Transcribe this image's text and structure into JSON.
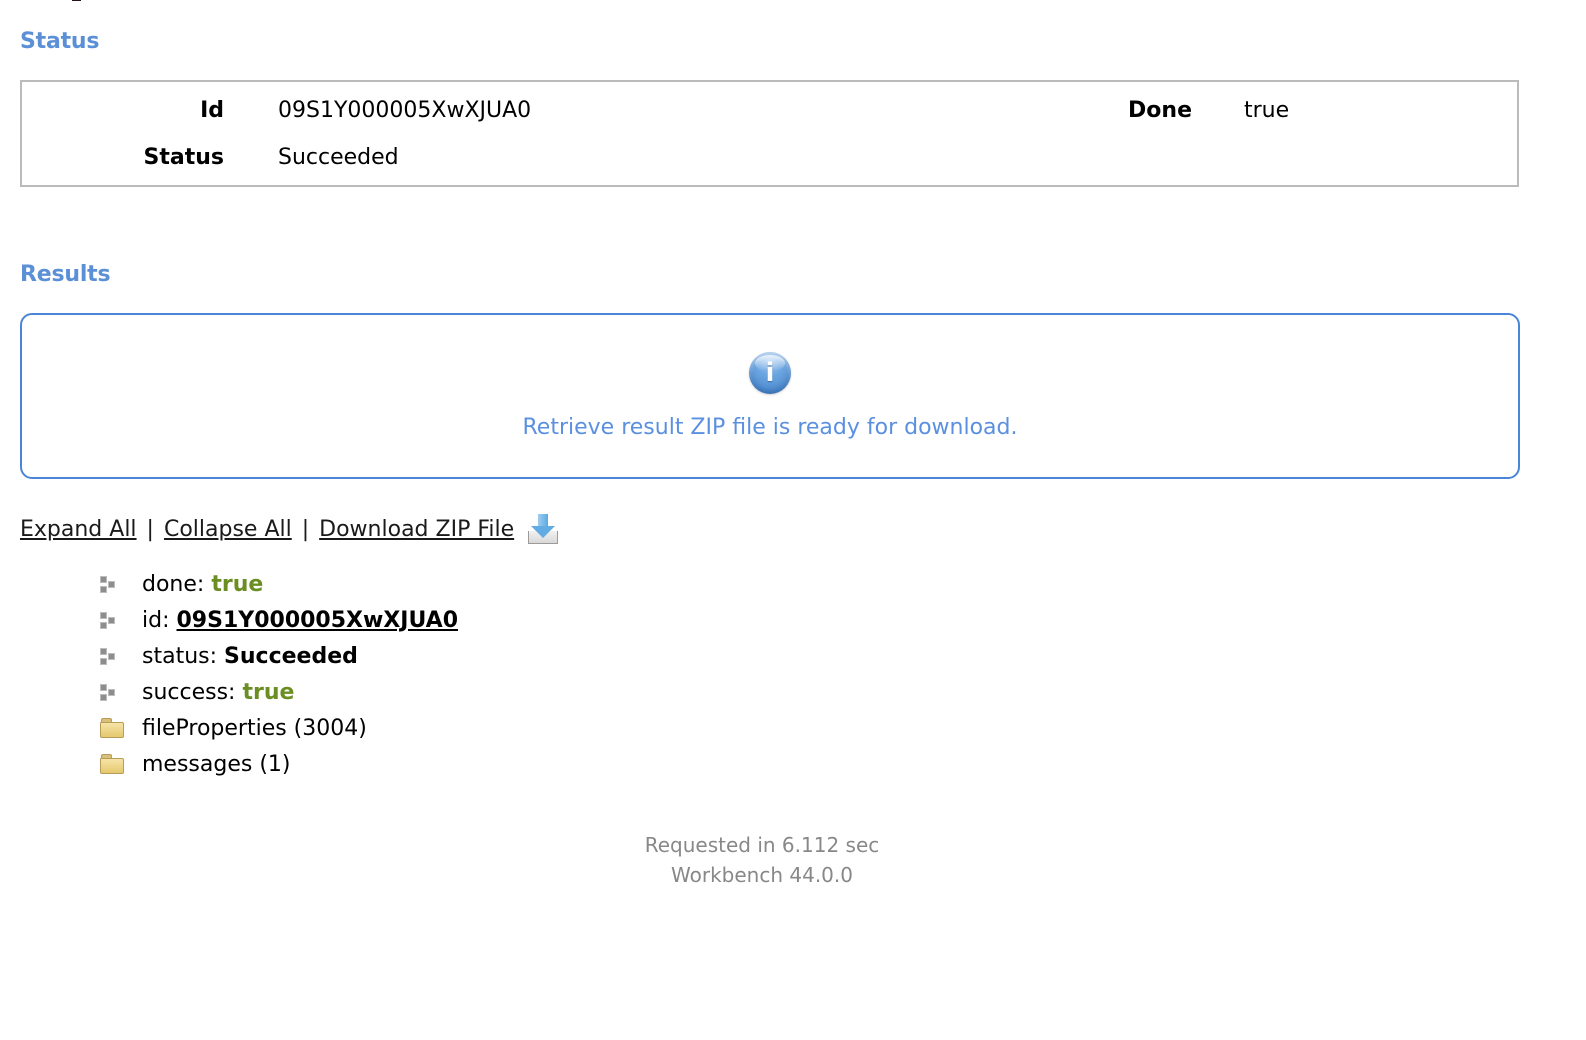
{
  "top_clip": {
    "note": "clipped-descender"
  },
  "sections": {
    "status_heading": "Status",
    "results_heading": "Results"
  },
  "status_box": {
    "rows": [
      {
        "label": "Id",
        "value": "09S1Y000005XwXJUA0",
        "label2": "Done",
        "value2": "true"
      },
      {
        "label": "Status",
        "value": "Succeeded",
        "label2": "",
        "value2": ""
      }
    ]
  },
  "results_panel": {
    "icon": "info-icon",
    "message": "Retrieve result ZIP file is ready for download.",
    "border_color": "#4a86d8",
    "text_color": "#5b90e0"
  },
  "link_bar": {
    "expand_all": "Expand All",
    "separator": "|",
    "collapse_all": "Collapse All",
    "download_zip": "Download ZIP File",
    "download_icon": "download-tray-icon"
  },
  "tree": {
    "items": [
      {
        "icon": "leaf-node-icon",
        "key": "done:",
        "value": "true",
        "value_style": "green"
      },
      {
        "icon": "leaf-node-icon",
        "key": "id:",
        "value": "09S1Y000005XwXJUA0",
        "value_style": "link"
      },
      {
        "icon": "leaf-node-icon",
        "key": "status:",
        "value": "Succeeded",
        "value_style": "bold"
      },
      {
        "icon": "leaf-node-icon",
        "key": "success:",
        "value": "true",
        "value_style": "green"
      },
      {
        "icon": "folder-icon",
        "key": "fileProperties (3004)",
        "value": "",
        "value_style": "none"
      },
      {
        "icon": "folder-icon",
        "key": "messages (1)",
        "value": "",
        "value_style": "none"
      }
    ]
  },
  "footer": {
    "requested": "Requested in 6.112 sec",
    "version": "Workbench 44.0.0"
  },
  "colors": {
    "heading_blue": "#5b8fd6",
    "info_blue": "#5b90e0",
    "panel_border_blue": "#4a86d8",
    "status_border_gray": "#bbbbbb",
    "true_green": "#6b8e23",
    "footer_gray": "#888888"
  }
}
